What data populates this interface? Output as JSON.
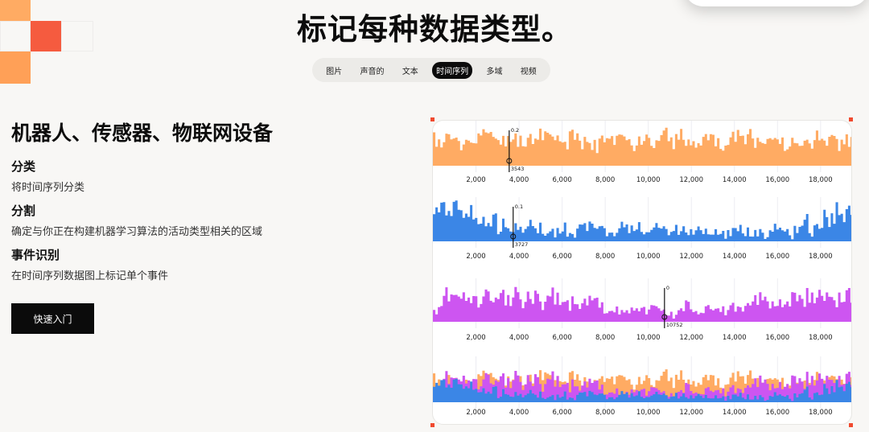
{
  "page": {
    "headline": "标记每种数据类型。",
    "colors": {
      "accent_orange": "#ffab63",
      "accent_red": "#f55b3f",
      "accent_blue": "#3b86e6",
      "accent_purple": "#cd55f1"
    }
  },
  "tabs": [
    {
      "label": "图片",
      "active": false
    },
    {
      "label": "声音的",
      "active": false
    },
    {
      "label": "文本",
      "active": false
    },
    {
      "label": "时间序列",
      "active": true
    },
    {
      "label": "多域",
      "active": false
    },
    {
      "label": "视频",
      "active": false
    }
  ],
  "content": {
    "title": "机器人、传感器、物联网设备",
    "features": [
      {
        "title": "分类",
        "desc": "将时间序列分类"
      },
      {
        "title": "分割",
        "desc": "确定与你正在构建机器学习算法的活动类型相关的区域"
      },
      {
        "title": "事件识别",
        "desc": "在时间序列数据图上标记单个事件"
      }
    ],
    "cta_label": "快速入门"
  },
  "chart_data": [
    {
      "type": "area",
      "color": "#ffab63",
      "x_ticks": [
        "2,000",
        "4,000",
        "6,000",
        "8,000",
        "10,000",
        "12,000",
        "14,000",
        "16,000",
        "18,000"
      ],
      "xlim": [
        0,
        19500
      ],
      "marker": {
        "x": 3543,
        "value_label": "0.2",
        "x_label": "3543"
      }
    },
    {
      "type": "area",
      "color": "#3b86e6",
      "x_ticks": [
        "2,000",
        "4,000",
        "6,000",
        "8,000",
        "10,000",
        "12,000",
        "14,000",
        "16,000",
        "18,000"
      ],
      "xlim": [
        0,
        19500
      ],
      "marker": {
        "x": 3727,
        "value_label": "0.1",
        "x_label": "3727"
      }
    },
    {
      "type": "area",
      "color": "#cd55f1",
      "x_ticks": [
        "2,000",
        "4,000",
        "6,000",
        "8,000",
        "10,000",
        "12,000",
        "14,000",
        "16,000",
        "18,000"
      ],
      "xlim": [
        0,
        19500
      ],
      "marker": {
        "x": 10752,
        "value_label": "0",
        "x_label": "10752"
      }
    },
    {
      "type": "area",
      "colors": [
        "#ffab63",
        "#cd55f1",
        "#3b86e6"
      ],
      "x_ticks": [
        "2,000",
        "4,000",
        "6,000",
        "8,000",
        "10,000",
        "12,000",
        "14,000",
        "16,000",
        "18,000"
      ],
      "xlim": [
        0,
        19500
      ]
    }
  ]
}
